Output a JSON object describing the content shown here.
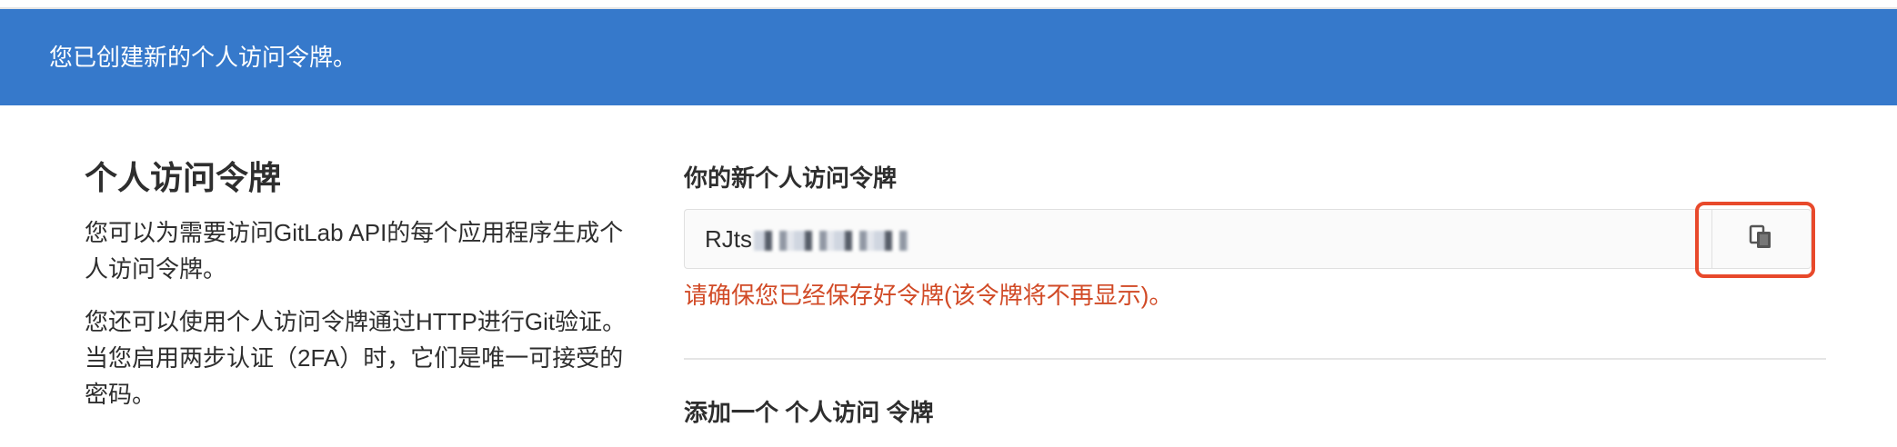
{
  "flash": {
    "message": "您已创建新的个人访问令牌。",
    "background_color": "#3679cb"
  },
  "sidebar": {
    "title": "个人访问令牌",
    "paragraph1": "您可以为需要访问GitLab API的每个应用程序生成个人访问令牌。",
    "paragraph2": "您还可以使用个人访问令牌通过HTTP进行Git验证。 当您启用两步认证（2FA）时，它们是唯一可接受的密码。"
  },
  "token": {
    "label": "你的新个人访问令牌",
    "value_visible_prefix": "RJts",
    "warning": "请确保您已经保存好令牌(该令牌将不再显示)。",
    "copy_icon": "clipboard-copy-icon",
    "highlight_color": "#e8492b"
  },
  "add_section": {
    "title": "添加一个 个人访问 令牌"
  }
}
